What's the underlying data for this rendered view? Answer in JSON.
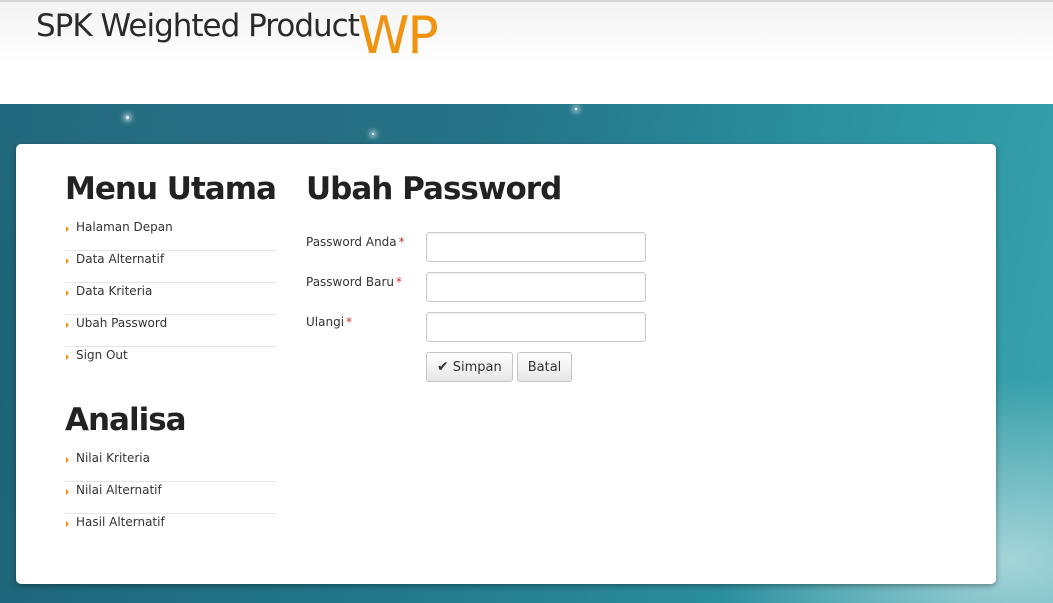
{
  "header": {
    "brand": "SPK Weighted Product",
    "brand_accent": "WP"
  },
  "sidebar": {
    "menu_title": "Menu Utama",
    "menu_items": [
      {
        "label": "Halaman Depan"
      },
      {
        "label": "Data Alternatif"
      },
      {
        "label": "Data Kriteria"
      },
      {
        "label": "Ubah Password"
      },
      {
        "label": "Sign Out"
      }
    ],
    "analisa_title": "Analisa",
    "analisa_items": [
      {
        "label": "Nilai Kriteria"
      },
      {
        "label": "Nilai Alternatif"
      },
      {
        "label": "Hasil Alternatif"
      }
    ]
  },
  "main": {
    "title": "Ubah Password",
    "fields": [
      {
        "label": "Password Anda",
        "required_mark": "*",
        "value": ""
      },
      {
        "label": "Password Baru",
        "required_mark": "*",
        "value": ""
      },
      {
        "label": "Ulangi",
        "required_mark": "*",
        "value": ""
      }
    ],
    "save_label": "Simpan",
    "save_icon": "check-icon",
    "cancel_label": "Batal"
  },
  "colors": {
    "accent": "#f0930e",
    "background": "#237a8c",
    "required": "#cc3333"
  }
}
